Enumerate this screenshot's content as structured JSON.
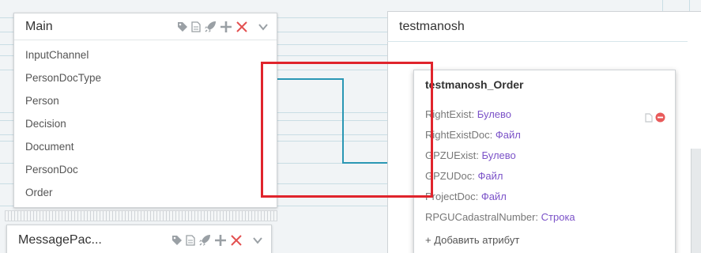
{
  "panels": {
    "main": {
      "title": "Main",
      "items": [
        "InputChannel",
        "PersonDocType",
        "Person",
        "Decision",
        "Document",
        "PersonDoc",
        "Order"
      ]
    },
    "message": {
      "title": "MessagePac..."
    },
    "testmanosh": {
      "title": "testmanosh"
    },
    "order": {
      "title": "testmanosh_Order",
      "attributes": [
        {
          "name": "RightExist: ",
          "type": "Булево"
        },
        {
          "name": "RightExistDoc: ",
          "type": "Файл"
        },
        {
          "name": "GPZUExist: ",
          "type": "Булево"
        },
        {
          "name": "GPZUDoc: ",
          "type": "Файл"
        },
        {
          "name": "ProjectDoc: ",
          "type": "Файл"
        },
        {
          "name": "RPGUCadastralNumber: ",
          "type": "Строка"
        }
      ],
      "add_attribute": "+ Добавить атрибут"
    }
  },
  "icons": [
    "tag-icon",
    "document-icon",
    "rocket-icon",
    "plus-icon",
    "close-icon",
    "chevron-down-icon",
    "file-icon",
    "remove-icon"
  ],
  "colors": {
    "connector": "#2a97b4",
    "highlight": "#e0242c",
    "attribute_type": "#7b52c8",
    "close": "#e35050",
    "add": "#e35050",
    "remove": "#e85a5a"
  }
}
